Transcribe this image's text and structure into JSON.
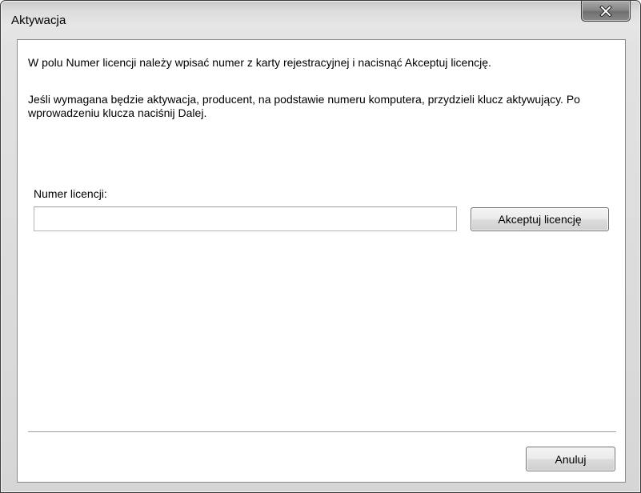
{
  "window": {
    "title": "Aktywacja",
    "close_glyph": "x"
  },
  "content": {
    "intro_text": "W polu Numer licencji należy wpisać numer z karty rejestracyjnej i nacisnąć Akceptuj licencję.",
    "activation_text": "Jeśli wymagana będzie aktywacja, producent, na podstawie numeru komputera, przydzieli klucz aktywujący. Po wprowadzeniu klucza naciśnij Dalej.",
    "license_label": "Numer licencji:",
    "license_value": "",
    "accept_button": "Akceptuj licencję",
    "cancel_button": "Anuluj"
  },
  "icons": {
    "close": "close-icon"
  }
}
